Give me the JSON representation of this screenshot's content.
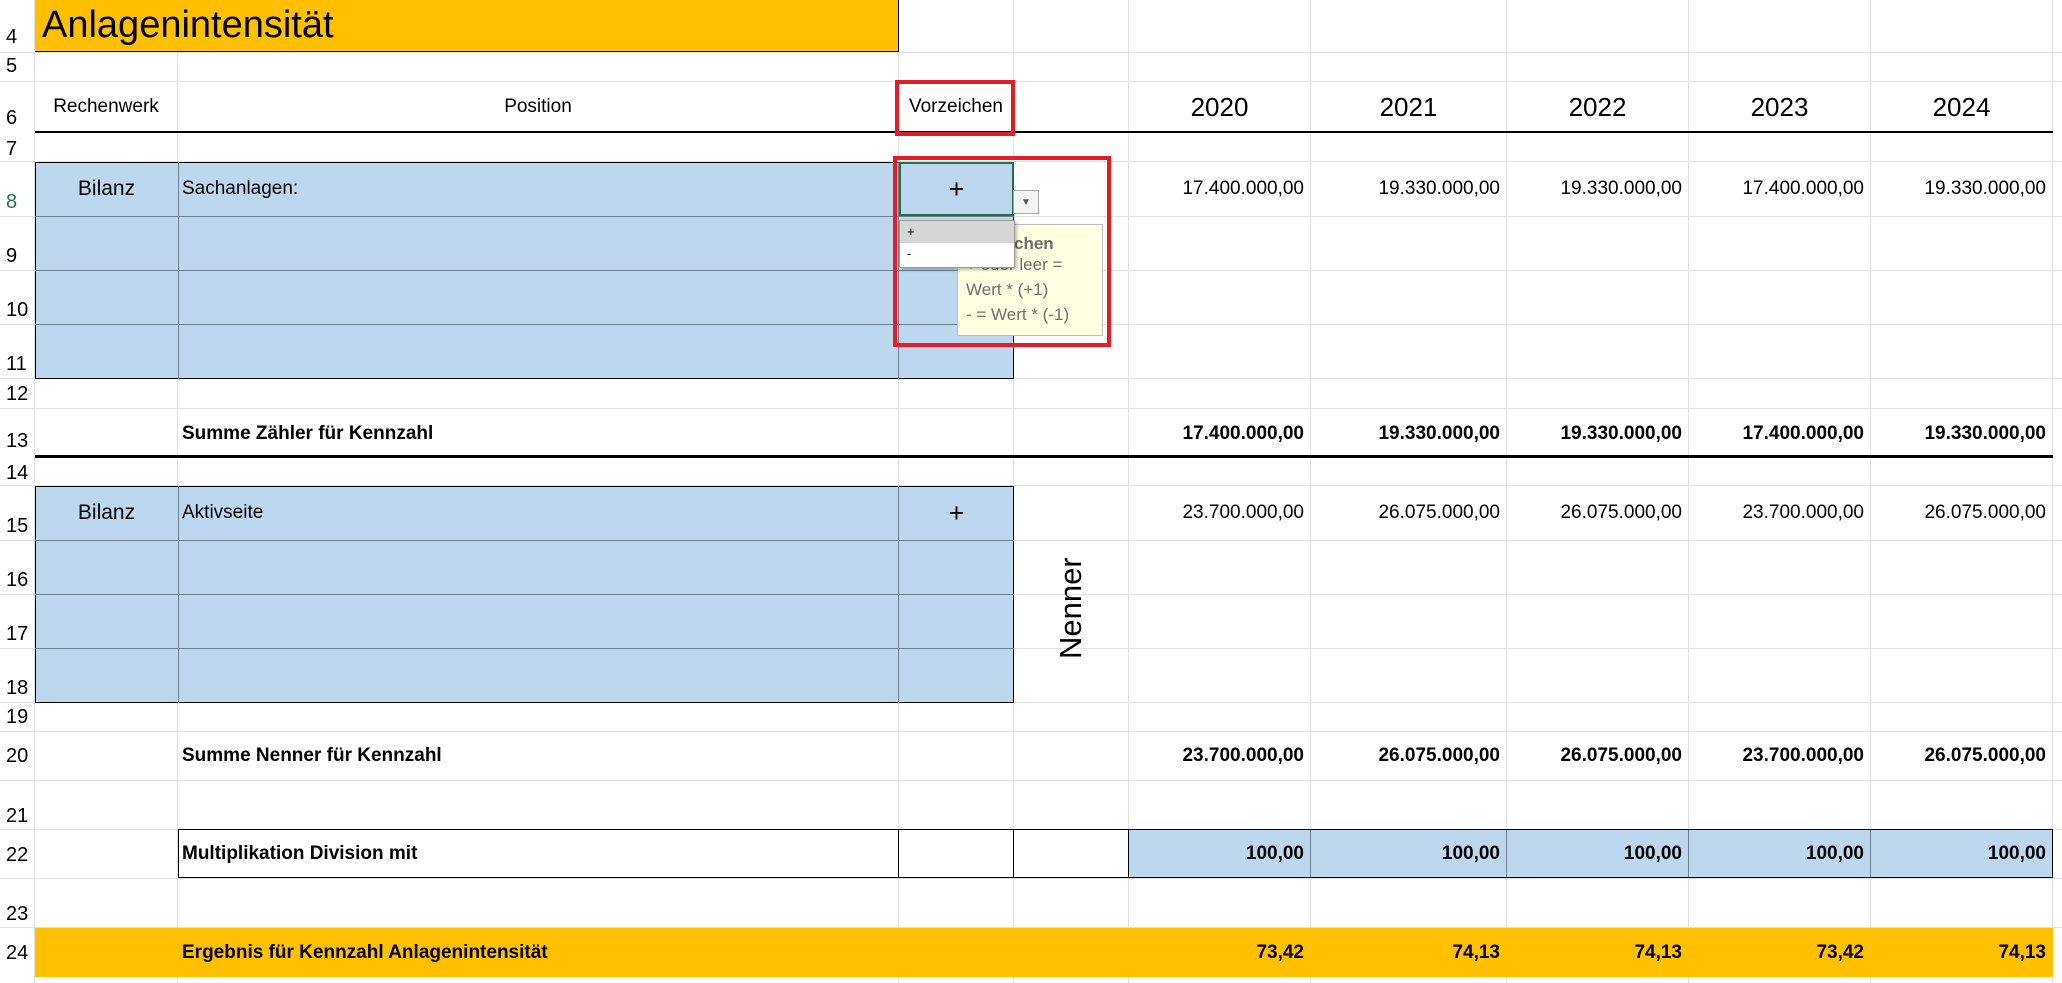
{
  "title": "Anlagenintensität",
  "row_numbers": [
    "4",
    "5",
    "6",
    "7",
    "8",
    "9",
    "10",
    "11",
    "12",
    "13",
    "14",
    "15",
    "16",
    "17",
    "18",
    "19",
    "20",
    "21",
    "22",
    "23",
    "24"
  ],
  "headers": {
    "rechenwerk": "Rechenwerk",
    "position": "Position",
    "vorzeichen": "Vorzeichen",
    "years": [
      "2020",
      "2021",
      "2022",
      "2023",
      "2024"
    ]
  },
  "zaehler": {
    "rechenwerk": "Bilanz",
    "position": "Sachanlagen:",
    "vorzeichen": "+",
    "values": [
      "17.400.000,00",
      "19.330.000,00",
      "19.330.000,00",
      "17.400.000,00",
      "19.330.000,00"
    ]
  },
  "summe_zaehler": {
    "label": "Summe Zähler für Kennzahl",
    "values": [
      "17.400.000,00",
      "19.330.000,00",
      "19.330.000,00",
      "17.400.000,00",
      "19.330.000,00"
    ]
  },
  "nenner": {
    "rechenwerk": "Bilanz",
    "position": "Aktivseite",
    "vorzeichen": "+",
    "side_label": "Nenner",
    "values": [
      "23.700.000,00",
      "26.075.000,00",
      "26.075.000,00",
      "23.700.000,00",
      "26.075.000,00"
    ]
  },
  "summe_nenner": {
    "label": "Summe Nenner für Kennzahl",
    "values": [
      "23.700.000,00",
      "26.075.000,00",
      "26.075.000,00",
      "23.700.000,00",
      "26.075.000,00"
    ]
  },
  "multiplikation": {
    "label": "Multiplikation Division mit",
    "values": [
      "100,00",
      "100,00",
      "100,00",
      "100,00",
      "100,00"
    ]
  },
  "ergebnis": {
    "label": "Ergebnis für Kennzahl Anlagenintensität",
    "values": [
      "73,42",
      "74,13",
      "74,13",
      "73,42",
      "74,13"
    ]
  },
  "dropdown": {
    "options": [
      "+",
      "-"
    ],
    "selected": "+"
  },
  "tooltip": {
    "title": "chen",
    "line1": "+ oder leer =",
    "line2": "Wert * (+1)",
    "line3": "- =  Wert * (-1)"
  },
  "colors": {
    "gold": "#ffc000",
    "input_blue": "#bdd7ee",
    "highlight_red": "#e31d25",
    "selected_row_number": "#217346"
  }
}
